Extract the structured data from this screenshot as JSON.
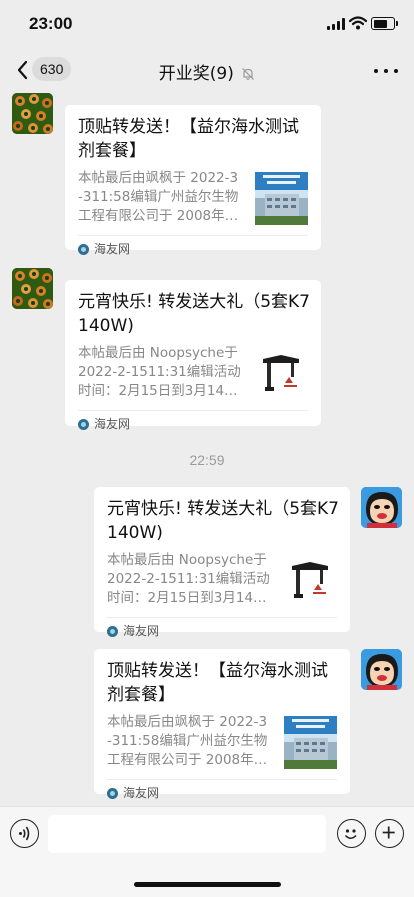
{
  "status_bar": {
    "time": "23:00"
  },
  "nav": {
    "back_count": "630",
    "title": "开业奖(9)"
  },
  "messages": [
    {
      "side": "left",
      "title": "顶贴转发送！【益尔海水测试剂套餐】",
      "desc_lines": [
        "本帖最后由飒枫于 2022-3",
        "-311:58编辑广州益尔生物",
        "工程有限公司于 2008年…"
      ],
      "source": "海友网",
      "thumb": "building"
    },
    {
      "side": "left",
      "title": "元宵快乐! 转发送大礼（5套K7 140W)",
      "desc_lines": [
        "本帖最后由 Noopsyche于",
        "2022-2-1511:31编辑活动",
        "时间：2月15日到3月14…"
      ],
      "source": "海友网",
      "thumb": "lamp"
    },
    {
      "side": "right",
      "title": "元宵快乐! 转发送大礼（5套K7 140W)",
      "desc_lines": [
        "本帖最后由 Noopsyche于",
        "2022-2-1511:31编辑活动",
        "时间：2月15日到3月14…"
      ],
      "source": "海友网",
      "thumb": "lamp"
    },
    {
      "side": "right",
      "title": "顶贴转发送！【益尔海水测试剂套餐】",
      "desc_lines": [
        "本帖最后由飒枫于 2022-3",
        "-311:58编辑广州益尔生物",
        "工程有限公司于 2008年…"
      ],
      "source": "海友网",
      "thumb": "building"
    }
  ],
  "timestamp": "22:59"
}
